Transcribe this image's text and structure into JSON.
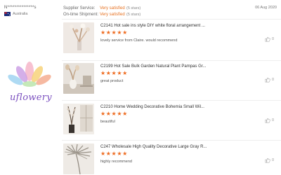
{
  "buyer": {
    "name": "N***************s",
    "country": "Australia"
  },
  "ratings": [
    {
      "label": "Supplier Service:",
      "value": "Very satisfied",
      "stars": "(5 stars)"
    },
    {
      "label": "On-time Shipment:",
      "value": "Very satisfied",
      "stars": "(5 stars)"
    }
  ],
  "review_date": "06 Aug 2020",
  "logo": {
    "text": "uflowery"
  },
  "items": [
    {
      "title": "C2141 Hot sale ins style DIY white floral arrangement ...",
      "stars": "★★★★★",
      "rating": 5,
      "comment": "lovely service from Claire. would recommend",
      "helpful": "0",
      "thumb": "pampas-white"
    },
    {
      "title": "C2199 Hot Sale Bulk Garden Natural Plant Pampas Gr...",
      "stars": "★★★★★",
      "rating": 5,
      "comment": "great product",
      "helpful": "0",
      "thumb": "pampas-vase"
    },
    {
      "title": "C2210 Home Wedding Decorative Bohemia Small Wil...",
      "stars": "★★★★★",
      "rating": 5,
      "comment": "beautiful",
      "helpful": "0",
      "thumb": "willow-window"
    },
    {
      "title": "C247 Wholesale High Quality Decorative Large Gray R...",
      "stars": "★★★★★",
      "rating": 5,
      "comment": "highly recommend",
      "helpful": "0",
      "thumb": "palm-leaf"
    }
  ]
}
